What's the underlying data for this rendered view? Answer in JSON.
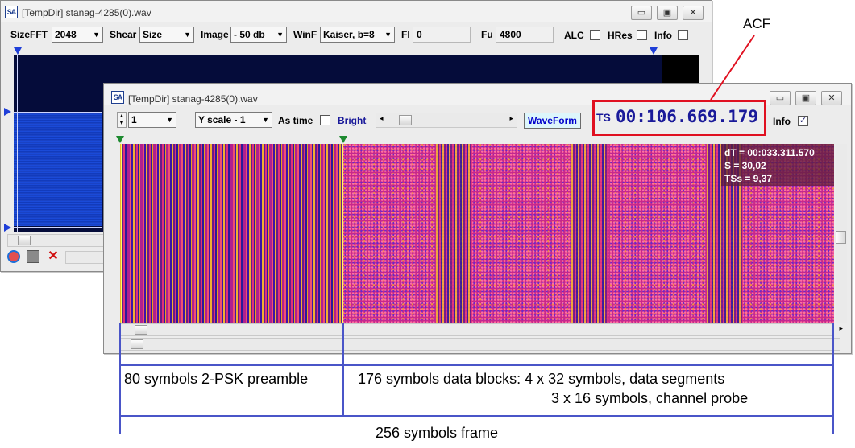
{
  "back_window": {
    "title": "[TempDir] stanag-4285(0).wav",
    "app_icon": "SA",
    "toolbar": {
      "sizefft_label": "SizeFFT",
      "sizefft_value": "2048",
      "shear_label": "Shear",
      "shear_value": "Size",
      "image_label": "Image",
      "image_value": "- 50 db",
      "winf_label": "WinF",
      "winf_value": "Kaiser, b=8",
      "fl_label": "Fl",
      "fl_value": "0",
      "fu_label": "Fu",
      "fu_value": "4800",
      "alc_label": "ALC",
      "hres_label": "HRes",
      "info_label": "Info"
    },
    "window_buttons": {
      "minimize": "▭",
      "maximize": "▣",
      "close": "✕"
    }
  },
  "front_window": {
    "title": "[TempDir] stanag-4285(0).wav",
    "app_icon": "SA",
    "toolbar": {
      "spin_value": "1",
      "yscale_value": "Y scale - 1",
      "as_time_label": "As time",
      "bright_label": "Bright",
      "waveform_label": "WaveForm",
      "ts_label": "TS",
      "ts_value": "00:106.669.179",
      "info_label": "Info",
      "info_checked": "✓"
    },
    "window_buttons": {
      "minimize": "▭",
      "maximize": "▣",
      "close": "✕"
    },
    "info_overlay": {
      "dt": "dT = 00:033.311.570",
      "s": "S = 30,02",
      "tss": "TSs = 9,37"
    }
  },
  "annotations": {
    "acf": "ACF",
    "preamble": "80 symbols 2-PSK preamble",
    "data_line1": "176 symbols data blocks: 4 x 32 symbols, data segments",
    "data_line2": "3 x 16 symbols, channel probe",
    "frame": "256 symbols frame"
  },
  "colors": {
    "highlight_red": "#e01020",
    "bracket_blue": "#4a55c8",
    "spectrum_dark": "#061040",
    "spectrum_blue": "#1040d0",
    "waveform_text": "#0000cc"
  }
}
